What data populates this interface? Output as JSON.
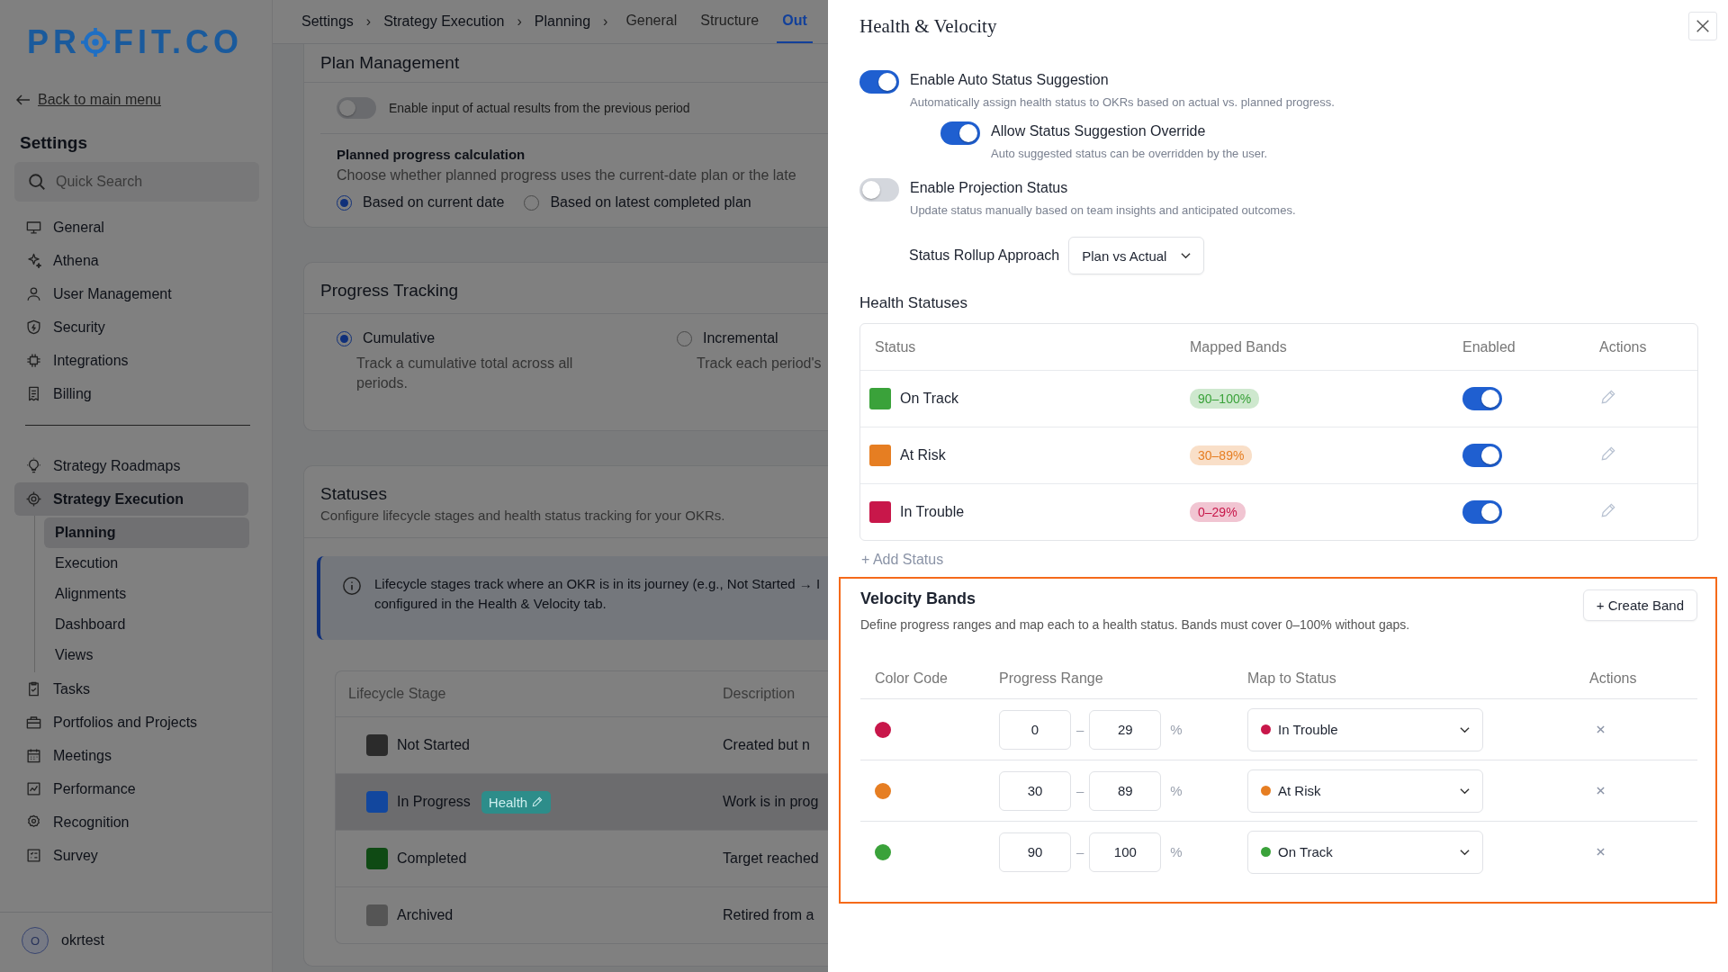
{
  "sidebar": {
    "logo": {
      "before": "PR",
      "after": "FIT.CO"
    },
    "back_link": "Back to main menu",
    "title": "Settings",
    "search": {
      "placeholder": "Quick Search"
    },
    "items": [
      {
        "label": "General",
        "selected": false
      },
      {
        "label": "Athena",
        "selected": false
      },
      {
        "label": "User Management",
        "selected": false
      },
      {
        "label": "Security",
        "selected": false
      },
      {
        "label": "Integrations",
        "selected": false
      },
      {
        "label": "Billing",
        "selected": false
      }
    ],
    "modules": [
      {
        "label": "Strategy Roadmaps",
        "selected": false
      },
      {
        "label": "Strategy Execution",
        "selected": true,
        "expanded": true,
        "children": [
          {
            "label": "Planning",
            "selected": true
          },
          {
            "label": "Execution",
            "selected": false
          },
          {
            "label": "Alignments",
            "selected": false
          },
          {
            "label": "Dashboard",
            "selected": false
          },
          {
            "label": "Views",
            "selected": false
          }
        ]
      },
      {
        "label": "Tasks",
        "selected": false
      },
      {
        "label": "Portfolios and Projects",
        "selected": false
      },
      {
        "label": "Meetings",
        "selected": false
      },
      {
        "label": "Performance",
        "selected": false
      },
      {
        "label": "Recognition",
        "selected": false
      },
      {
        "label": "Survey",
        "selected": false
      }
    ],
    "user": {
      "initial": "O",
      "name": "okrtest"
    }
  },
  "breadcrumb": {
    "items": [
      "Settings",
      "Strategy Execution",
      "Planning"
    ],
    "separator": "›"
  },
  "tabs": [
    {
      "label": "General",
      "selected": false
    },
    {
      "label": "Structure",
      "selected": false
    },
    {
      "label": "Out",
      "selected": true
    }
  ],
  "plan_management": {
    "title": "Plan Management",
    "toggle": {
      "label": "Enable input of actual results from the previous period",
      "on": false
    },
    "planned_progress": {
      "title": "Planned progress calculation",
      "description": "Choose whether planned progress uses the current-date plan or the late",
      "options": [
        {
          "label": "Based on current date",
          "selected": true
        },
        {
          "label": "Based on latest completed plan",
          "selected": false
        }
      ]
    }
  },
  "progress_tracking": {
    "title": "Progress Tracking",
    "options": [
      {
        "label": "Cumulative",
        "description": "Track a cumulative total across all periods.",
        "selected": true
      },
      {
        "label": "Incremental",
        "description": "Track each period's",
        "selected": false
      }
    ]
  },
  "statuses": {
    "title": "Statuses",
    "description": "Configure lifecycle stages and health status tracking for your OKRs.",
    "info_lines": [
      "Lifecycle stages track where an OKR is in its journey (e.g., Not Started → I",
      "configured in the Health & Velocity tab."
    ],
    "table": {
      "columns": [
        "Lifecycle Stage",
        "Description"
      ],
      "rows": [
        {
          "stage": "Not Started",
          "color": "#2b2b2b",
          "description": "Created but n",
          "highlighted": false
        },
        {
          "stage": "In Progress",
          "color": "#12479e",
          "badge": "Health",
          "description": "Work is in prog",
          "highlighted": true
        },
        {
          "stage": "Completed",
          "color": "#0f4a14",
          "description": "Target reached",
          "highlighted": false
        },
        {
          "stage": "Archived",
          "color": "#555555",
          "description": "Retired from a",
          "highlighted": false
        }
      ]
    }
  },
  "drawer": {
    "title": "Health & Velocity",
    "settings": [
      {
        "label": "Enable Auto Status Suggestion",
        "description": "Automatically assign health status to OKRs based on actual vs. planned progress.",
        "on": true,
        "children": [
          {
            "label": "Allow Status Suggestion Override",
            "description": "Auto suggested status can be overridden by the user.",
            "on": true
          }
        ]
      },
      {
        "label": "Enable Projection Status",
        "description": "Update status manually based on team insights and anticipated outcomes.",
        "on": false
      }
    ],
    "rollup": {
      "label": "Status Rollup Approach",
      "value": "Plan vs Actual"
    },
    "health_statuses": {
      "title": "Health Statuses",
      "columns": [
        "Status",
        "Mapped Bands",
        "Enabled",
        "Actions"
      ],
      "rows": [
        {
          "name": "On Track",
          "color": "#3aa23a",
          "band": "90–100%",
          "enabled": true
        },
        {
          "name": "At Risk",
          "color": "#e67e22",
          "band": "30–89%",
          "enabled": true
        },
        {
          "name": "In Trouble",
          "color": "#c8174a",
          "band": "0–29%",
          "enabled": true
        }
      ],
      "add": "+ Add Status"
    },
    "velocity_bands": {
      "title": "Velocity Bands",
      "description": "Define progress ranges and map each to a health status. Bands must cover 0–100% without gaps.",
      "create_button": "+ Create Band",
      "highlighted": true,
      "columns": [
        "Color Code",
        "Progress Range",
        "Map to Status",
        "Actions"
      ],
      "rows": [
        {
          "color": "#c8174a",
          "from": "0",
          "separator": "–",
          "to": "29",
          "unit": "%",
          "status": {
            "name": "In Trouble",
            "color": "#c8174a"
          }
        },
        {
          "color": "#e67e22",
          "from": "30",
          "separator": "–",
          "to": "89",
          "unit": "%",
          "status": {
            "name": "At Risk",
            "color": "#e67e22"
          }
        },
        {
          "color": "#3aa23a",
          "from": "90",
          "separator": "–",
          "to": "100",
          "unit": "%",
          "status": {
            "name": "On Track",
            "color": "#3aa23a"
          }
        }
      ]
    }
  }
}
